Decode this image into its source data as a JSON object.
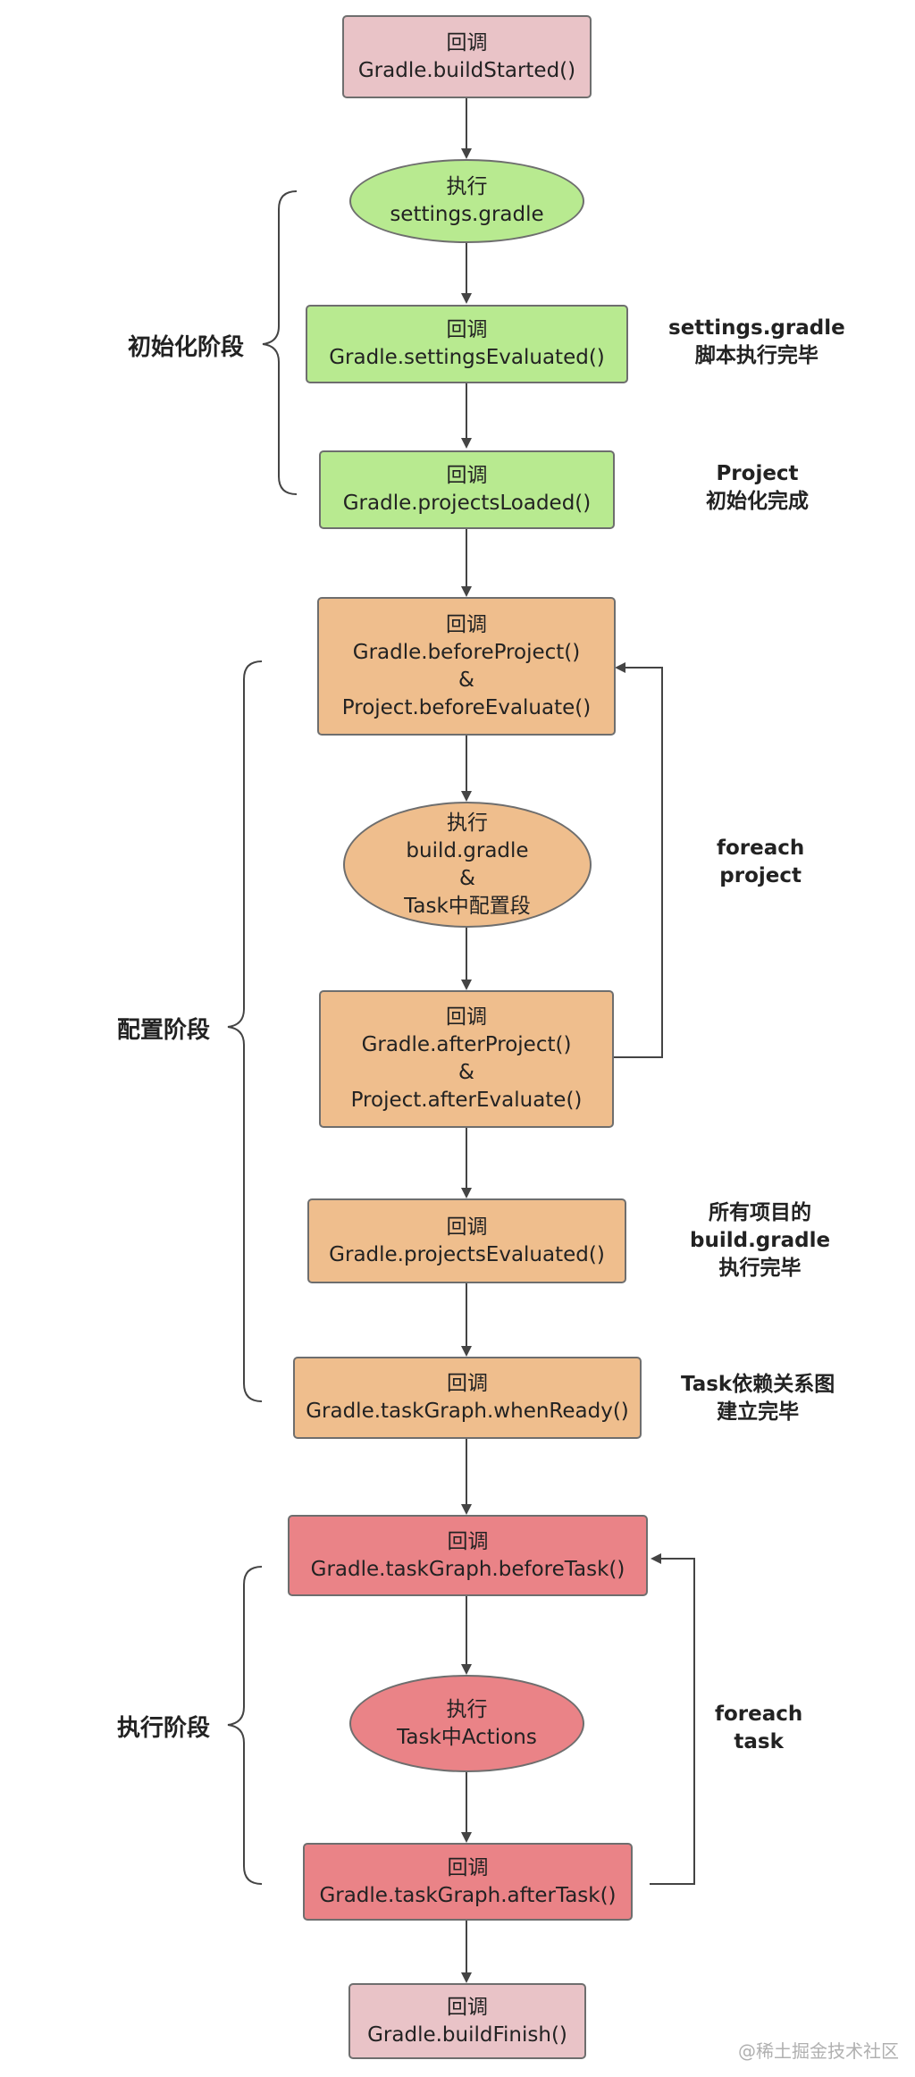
{
  "nodes": {
    "build_started": [
      "回调",
      "Gradle.buildStarted()"
    ],
    "exec_settings": [
      "执行",
      "settings.gradle"
    ],
    "settings_evaluated": [
      "回调",
      "Gradle.settingsEvaluated()"
    ],
    "projects_loaded": [
      "回调",
      "Gradle.projectsLoaded()"
    ],
    "before_project": [
      "回调",
      "Gradle.beforeProject()",
      "&",
      "Project.beforeEvaluate()"
    ],
    "exec_build": [
      "执行",
      "build.gradle",
      "&",
      "Task中配置段"
    ],
    "after_project": [
      "回调",
      "Gradle.afterProject()",
      "&",
      "Project.afterEvaluate()"
    ],
    "projects_evaluated": [
      "回调",
      "Gradle.projectsEvaluated()"
    ],
    "task_graph_ready": [
      "回调",
      "Gradle.taskGraph.whenReady()"
    ],
    "before_task": [
      "回调",
      "Gradle.taskGraph.beforeTask()"
    ],
    "exec_actions": [
      "执行",
      "Task中Actions"
    ],
    "after_task": [
      "回调",
      "Gradle.taskGraph.afterTask()"
    ],
    "build_finish": [
      "回调",
      "Gradle.buildFinish()"
    ]
  },
  "phases": {
    "init": "初始化阶段",
    "config": "配置阶段",
    "exec": "执行阶段"
  },
  "notes": {
    "settings_done": [
      "settings.gradle",
      "脚本执行完毕"
    ],
    "project_init": [
      "Project",
      "初始化完成"
    ],
    "foreach_project": [
      "foreach",
      "project"
    ],
    "all_build_done": [
      "所有项目的",
      "build.gradle",
      "执行完毕"
    ],
    "task_graph_built": [
      "Task依赖关系图",
      "建立完毕"
    ],
    "foreach_task": [
      "foreach",
      "task"
    ]
  },
  "watermark": "@稀土掘金技术社区",
  "colors": {
    "pink": "#e9c3c7",
    "green": "#b8ea90",
    "orange": "#efbe8d",
    "red": "#ea8387",
    "border": "#6e6e6e",
    "arrow": "#444444"
  }
}
